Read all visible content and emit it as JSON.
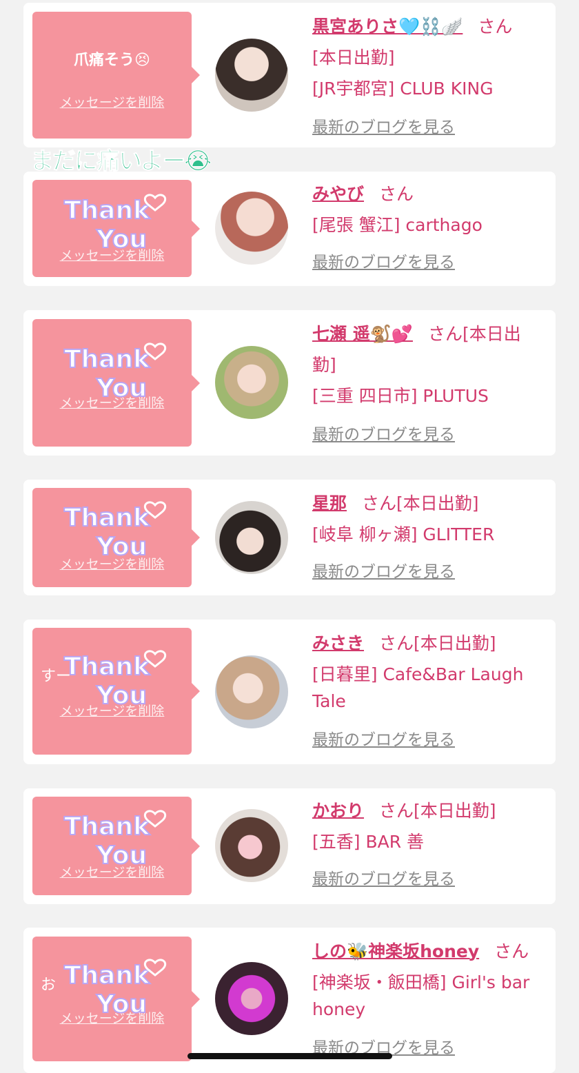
{
  "colors": {
    "accent": "#d23a6c",
    "bubble": "#f5949d",
    "overlay": "#2fbf8c"
  },
  "overlay_caption": "まだに痛いよー😭",
  "cards": [
    {
      "message": "爪痛そう😣",
      "delete": "メッセージを削除",
      "sticker": false,
      "name": "黒宮ありさ🩵⛓️🪽",
      "san": "さん",
      "lines": [
        "[本日出勤]",
        "[JR宇都宮] CLUB KING"
      ],
      "blog": "最新のブログを見る"
    },
    {
      "message": "",
      "delete": "メッセージを削除",
      "sticker": true,
      "sticker_text": [
        "Thank",
        "You"
      ],
      "name": "みやび",
      "san": "さん",
      "lines": [
        "[尾張 蟹江] carthago"
      ],
      "blog": "最新のブログを見る"
    },
    {
      "message": "",
      "delete": "メッセージを削除",
      "sticker": true,
      "sticker_text": [
        "Thank",
        "You"
      ],
      "name": "七瀬 遥🐒💕",
      "san": "さん[本日出",
      "lines": [
        "勤]",
        "[三重 四日市] PLUTUS"
      ],
      "blog": "最新のブログを見る"
    },
    {
      "message": "",
      "delete": "メッセージを削除",
      "sticker": true,
      "sticker_text": [
        "Thank",
        "You"
      ],
      "name": "星那",
      "san": "さん[本日出勤]",
      "lines": [
        "[岐阜 柳ヶ瀬] GLITTER"
      ],
      "blog": "最新のブログを見る"
    },
    {
      "message": "すー",
      "delete": "メッセージを削除",
      "sticker": true,
      "sticker_text": [
        "Thank",
        "You"
      ],
      "name": "みさき",
      "san": "さん[本日出勤]",
      "lines": [
        "[日暮里] Cafe&Bar Laugh",
        "Tale"
      ],
      "blog": "最新のブログを見る"
    },
    {
      "message": "",
      "delete": "メッセージを削除",
      "sticker": true,
      "sticker_text": [
        "Thank",
        "You"
      ],
      "name": "かおり",
      "san": "さん[本日出勤]",
      "lines": [
        "[五香] BAR 善"
      ],
      "blog": "最新のブログを見る"
    },
    {
      "message": "お",
      "delete": "メッセージを削除",
      "sticker": true,
      "sticker_text": [
        "Thank",
        "You"
      ],
      "name": "しの🐝神楽坂honey",
      "san": "さん",
      "lines": [
        "[神楽坂・飯田橋] Girl's bar",
        "honey"
      ],
      "blog": "最新のブログを見る"
    }
  ]
}
